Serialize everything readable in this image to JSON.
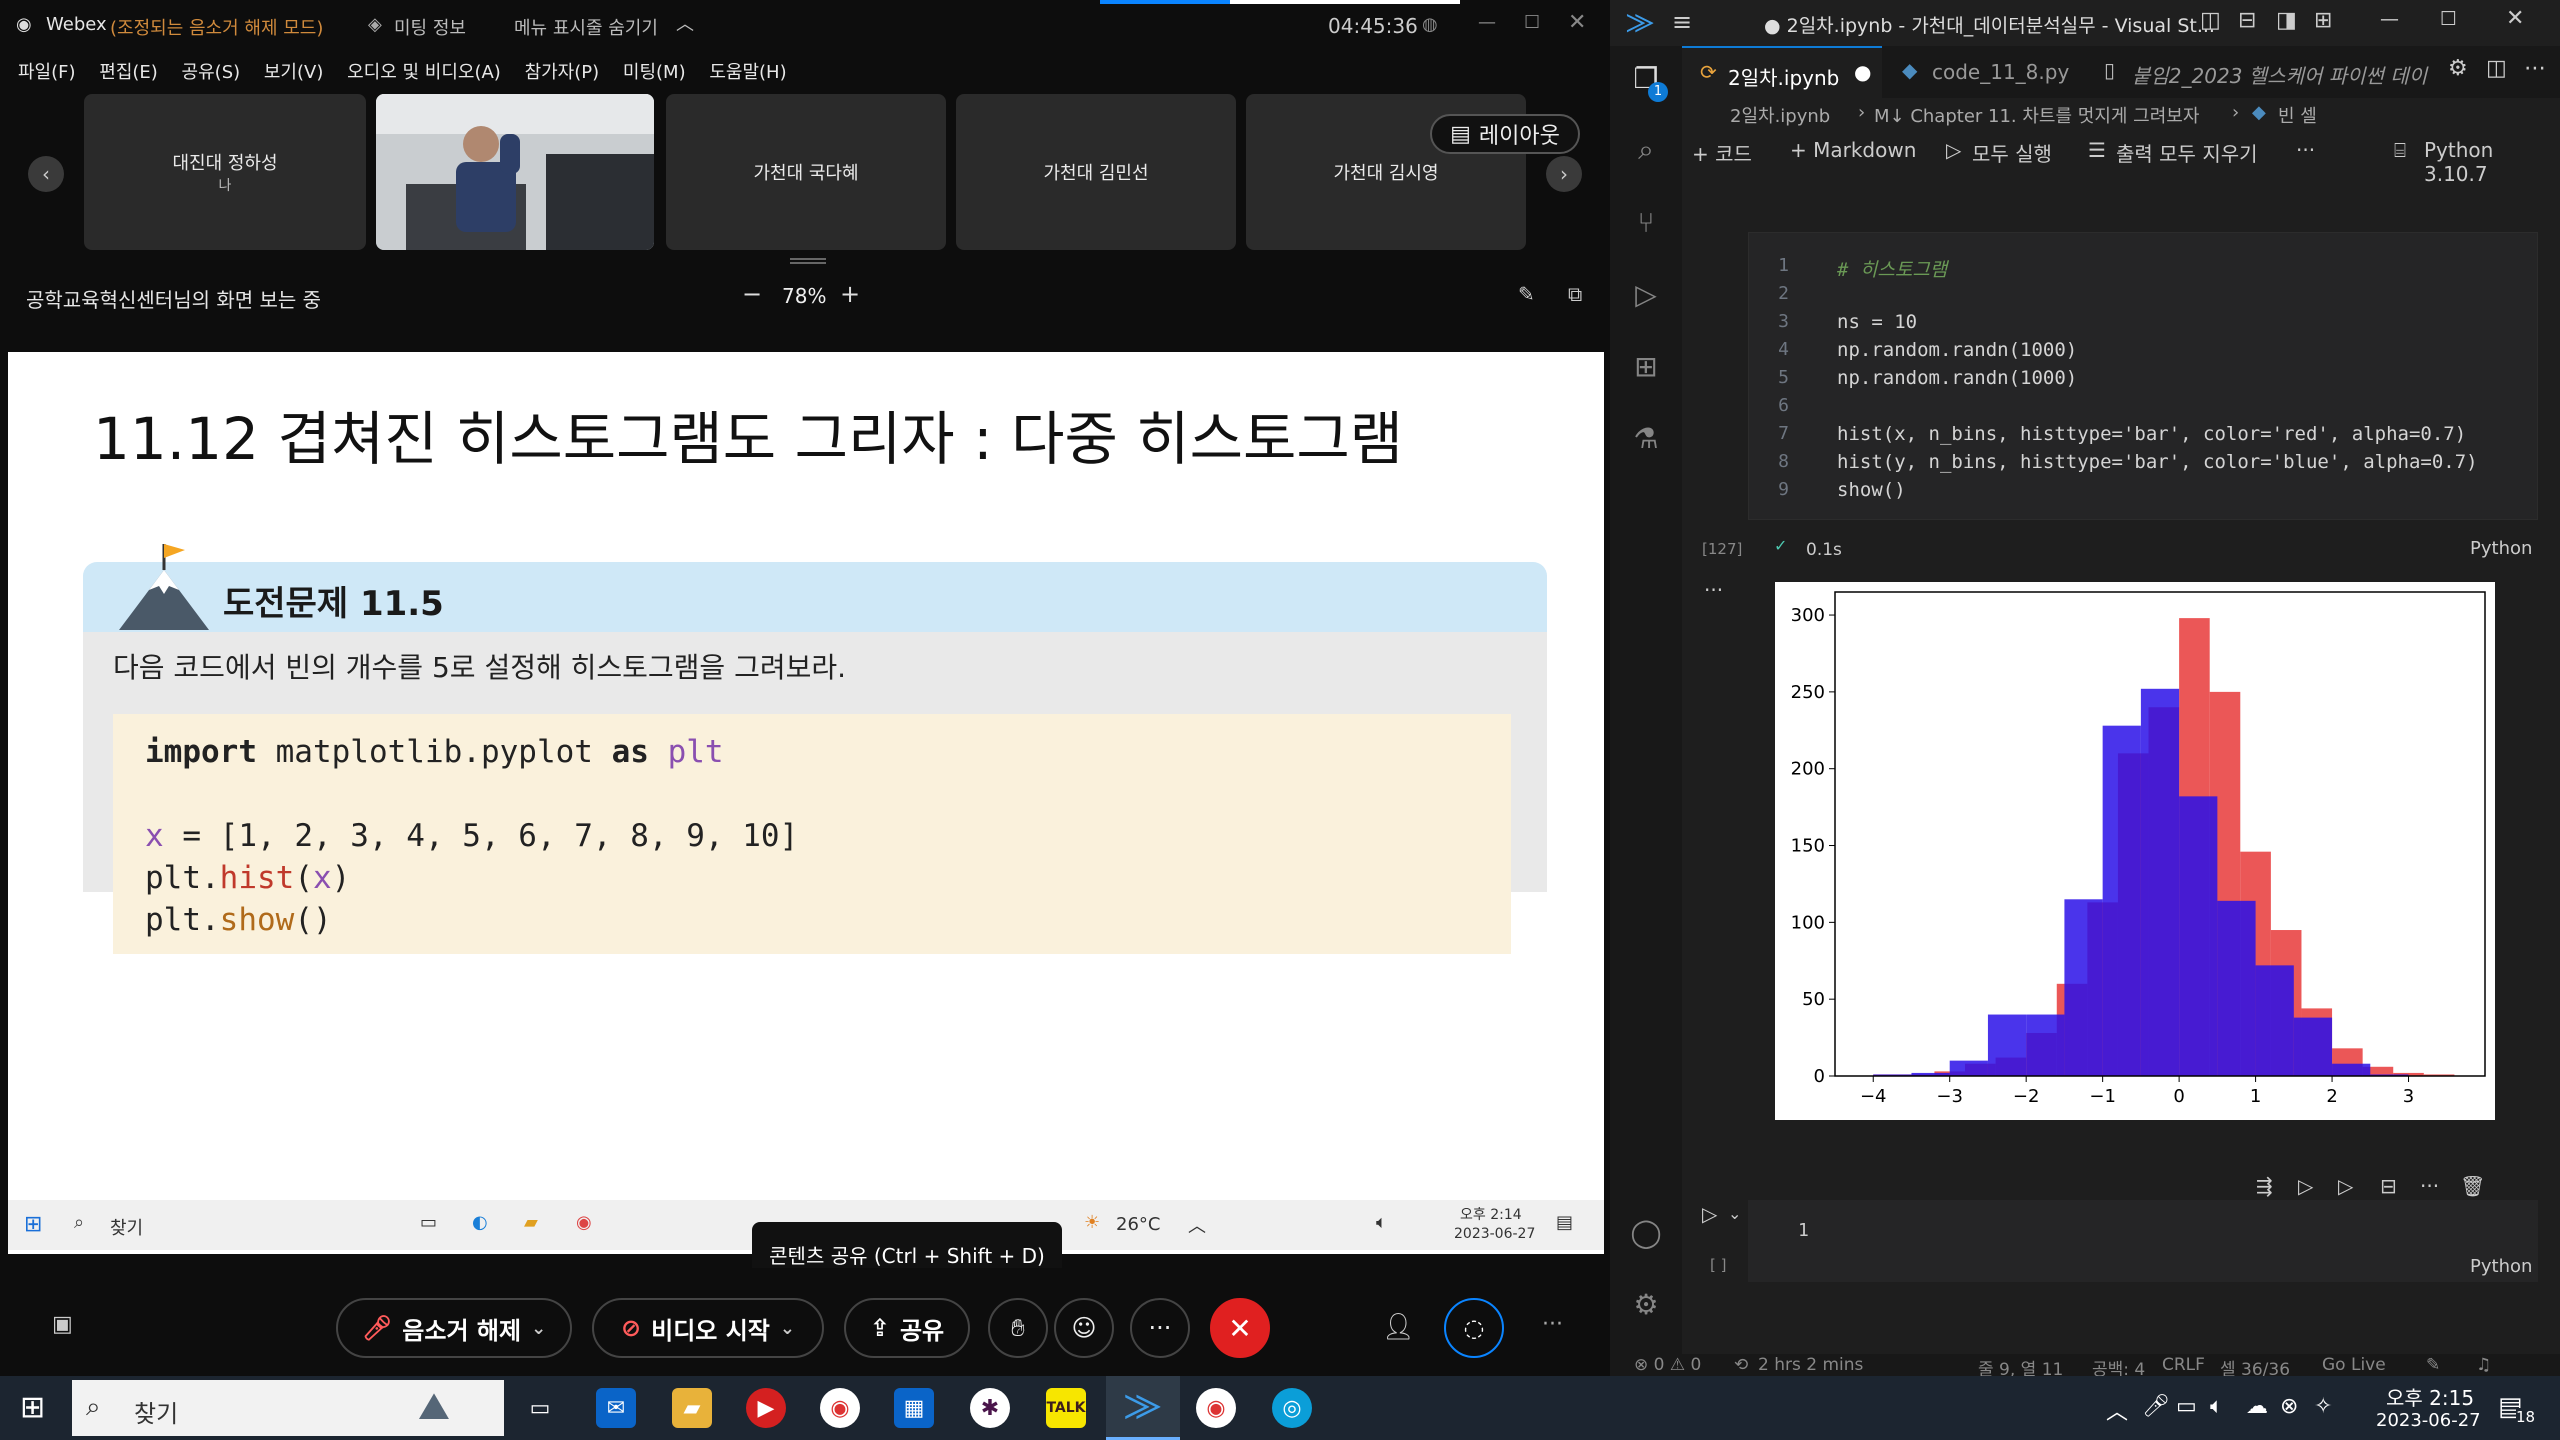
{
  "webex": {
    "app_name": "Webex",
    "mute_status": "(조정되는 음소거 해제 모드)",
    "meeting_info": "미팅 정보",
    "hide_menu": "메뉴 표시줄 숨기기",
    "clock": "04:45:36",
    "menu": [
      "파일(F)",
      "편집(E)",
      "공유(S)",
      "보기(V)",
      "오디오 및 비디오(A)",
      "참가자(P)",
      "미팅(M)",
      "도움말(H)"
    ],
    "participants": [
      {
        "name": "대진대 정하성",
        "sub": "나"
      },
      {
        "name": "",
        "sub": ""
      },
      {
        "name": "가천대 국다혜",
        "sub": ""
      },
      {
        "name": "가천대 김민선",
        "sub": ""
      },
      {
        "name": "가천대 김시영",
        "sub": ""
      }
    ],
    "layout_button": "레이아웃",
    "viewing_text": "공학교육혁신센터님의 화면 보는 중",
    "zoom": "78%",
    "zoom_minus": "−",
    "zoom_plus": "+",
    "bottom": {
      "unmute": "음소거 해제",
      "video": "비디오 시작",
      "share": "공유"
    },
    "tooltip": "콘텐츠 공유 (Ctrl + Shift + D)"
  },
  "slide": {
    "title": "11.12 겹쳐진 히스토그램도 그리자 : 다중 히스토그램",
    "challenge": "도전문제 11.5",
    "instruction": "다음 코드에서 빈의 개수를 5로 설정해 히스토그램을 그려보라.",
    "code": [
      "import matplotlib.pyplot as plt",
      "",
      "x = [1, 2, 3, 4, 5, 6, 7, 8, 9, 10]",
      "plt.hist(x)",
      "plt.show()"
    ]
  },
  "inner_taskbar": {
    "search": "찾기",
    "weather": "26°C",
    "time": "오후 2:14",
    "date": "2023-06-27"
  },
  "vscode": {
    "title": "● 2일차.ipynb - 가천대_데이터분석실무 - Visual St...",
    "tabs": [
      "2일차.ipynb",
      "code_11_8.py",
      "붙임2_2023 헬스케어 파이썬 데이"
    ],
    "breadcrumb": [
      "2일차.ipynb",
      "M↓ Chapter 11. 차트를 멋지게 그려보자",
      "빈 셀"
    ],
    "toolbar": {
      "code": "+ 코드",
      "markdown": "+ Markdown",
      "run_all": "모두 실행",
      "clear": "출력 모두 지우기",
      "more": "···",
      "kernel": "Python 3.10.7"
    },
    "cell_lines": [
      "# 히스토그램",
      "",
      "ns = 10",
      "np.random.randn(1000)",
      "np.random.randn(1000)",
      "",
      "hist(x, n_bins, histtype='bar', color='red', alpha=0.7)",
      "hist(y, n_bins, histtype='bar', color='blue', alpha=0.7)",
      "show()"
    ],
    "line_numbers": [
      "1",
      "2",
      "3",
      "4",
      "5",
      "6",
      "7",
      "8",
      "9"
    ],
    "exec_count": "[127]",
    "exec_time": "0.1s",
    "lang": "Python",
    "empty_cell_line": "1",
    "empty_cell_count": "[ ]",
    "status": {
      "errors": "⊗ 0 ⚠ 0",
      "time": "2 hrs 2 mins",
      "pos": "줄 9, 열 11",
      "spaces": "공백: 4",
      "eol": "CRLF",
      "cell": "셀 36/36",
      "golive": "Go Live"
    }
  },
  "chart_data": {
    "type": "bar",
    "title": "",
    "xlabel": "",
    "ylabel": "",
    "xlim": [
      -4.5,
      4.0
    ],
    "ylim": [
      0,
      315
    ],
    "xticks": [
      -4,
      -3,
      -2,
      -1,
      0,
      1,
      2,
      3
    ],
    "yticks": [
      0,
      50,
      100,
      150,
      200,
      250,
      300
    ],
    "series": [
      {
        "color": "#e8393a",
        "edges": [
          -4.0,
          -3.6,
          -3.2,
          -2.8,
          -2.4,
          -2.0,
          -1.6,
          -1.2,
          -0.8,
          -0.4,
          0.0,
          0.4,
          0.8,
          1.2,
          1.6,
          2.0,
          2.4,
          2.8,
          3.2,
          3.6
        ],
        "values": [
          1,
          1,
          3,
          8,
          12,
          28,
          60,
          113,
          210,
          240,
          298,
          250,
          146,
          95,
          44,
          18,
          6,
          2,
          1
        ]
      },
      {
        "color": "#2a10e8",
        "edges": [
          -4.5,
          -4.0,
          -3.5,
          -3.0,
          -2.5,
          -2.0,
          -1.5,
          -1.0,
          -0.5,
          0.0,
          0.5,
          1.0,
          1.5,
          2.0,
          2.5,
          3.0
        ],
        "values": [
          0,
          1,
          2,
          10,
          40,
          40,
          115,
          228,
          252,
          182,
          114,
          72,
          38,
          8,
          1
        ]
      }
    ]
  },
  "taskbar": {
    "search": "찾기",
    "time": "오후 2:15",
    "date": "2023-06-27",
    "badge": "18"
  },
  "colors": {
    "accent": "#0a84ff",
    "end_call": "#e02020",
    "vs_bg": "#1e1e1e"
  }
}
